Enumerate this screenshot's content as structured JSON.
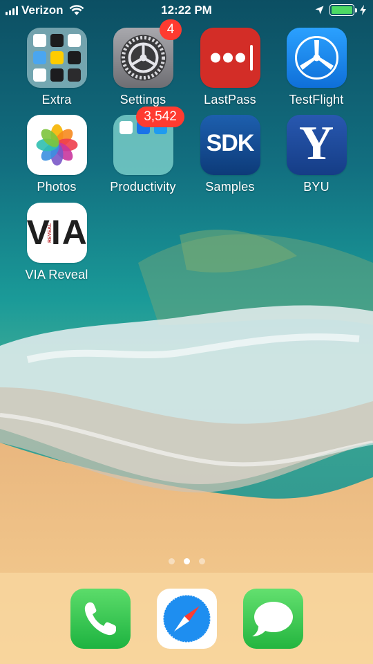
{
  "status_bar": {
    "carrier": "Verizon",
    "time": "12:22 PM",
    "battery_level": 1.0,
    "colors": {
      "battery": "#4cd964"
    }
  },
  "home_screen": {
    "apps": [
      {
        "id": "extra",
        "label": "Extra",
        "type": "folder"
      },
      {
        "id": "settings",
        "label": "Settings",
        "badge": "4"
      },
      {
        "id": "lastpass",
        "label": "LastPass"
      },
      {
        "id": "testflight",
        "label": "TestFlight"
      },
      {
        "id": "photos",
        "label": "Photos"
      },
      {
        "id": "productivity",
        "label": "Productivity",
        "type": "folder",
        "badge": "3,542"
      },
      {
        "id": "samples",
        "label": "Samples",
        "icon_text": "SDK"
      },
      {
        "id": "byu",
        "label": "BYU",
        "icon_text": "Y"
      },
      {
        "id": "via-reveal",
        "label": "VIA Reveal",
        "icon_text": "VIA",
        "icon_subtext": "REVEAL"
      }
    ],
    "page_count": 3,
    "current_page": 2
  },
  "dock": {
    "apps": [
      {
        "id": "phone",
        "icon": "phone-icon"
      },
      {
        "id": "safari",
        "icon": "compass-icon"
      },
      {
        "id": "messages",
        "icon": "speech-bubble-icon"
      }
    ]
  },
  "colors": {
    "badge": "#ff3b30",
    "lastpass": "#d32d27",
    "testflight": "#1e8ef0",
    "samples": "#0d4a8f",
    "byu": "#1b4aa0",
    "phone": "#2ecc50",
    "messages": "#34c759"
  }
}
